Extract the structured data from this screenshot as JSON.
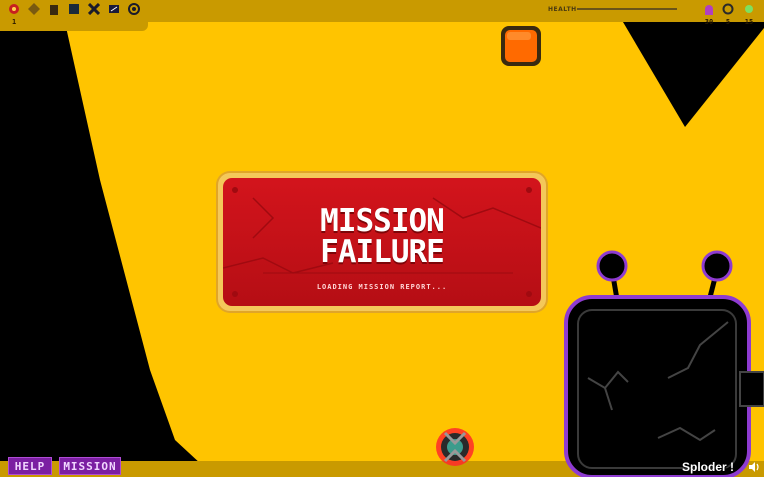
{
  "hud": {
    "counter_left": "1",
    "health_label": "HEALTH",
    "health_level_percent": 0,
    "right_stats": [
      {
        "icon": "enemy-icon",
        "value": "30"
      },
      {
        "icon": "ring-icon",
        "value": "5"
      },
      {
        "icon": "gem-icon",
        "value": "15"
      }
    ],
    "tool_icons": [
      "shield-icon",
      "mine-icon",
      "building-icon",
      "box-icon",
      "crossed-swords-icon",
      "map-icon",
      "target-icon"
    ]
  },
  "modal": {
    "title_line1": "MISSION",
    "title_line2": "FAILURE",
    "subtitle": "LOADING MISSION REPORT..."
  },
  "bottom": {
    "help_label": "HELP",
    "mission_label": "MISSION",
    "brand": "Sploder !"
  },
  "colors": {
    "background": "#ffc400",
    "terrain": "#000000",
    "modal_red": "#d3141c",
    "button_purple": "#7b1fa2",
    "robot_outline": "#8e3bd1"
  }
}
